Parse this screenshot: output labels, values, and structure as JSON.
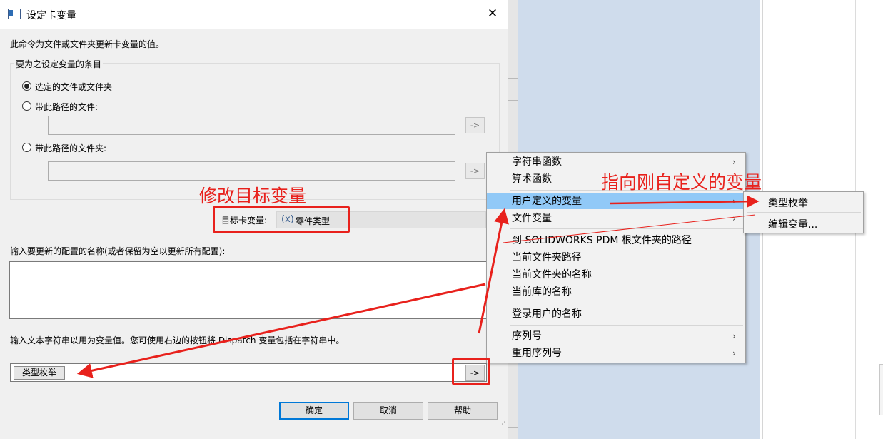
{
  "dialog": {
    "title": "设定卡变量",
    "description": "此命令为文件或文件夹更新卡变量的值。",
    "group_title": "要为之设定变量的条目",
    "radio_options": [
      {
        "label": "选定的文件或文件夹",
        "checked": true
      },
      {
        "label": "带此路径的文件:",
        "checked": false
      },
      {
        "label": "带此路径的文件夹:",
        "checked": false
      }
    ],
    "path_file_value": "",
    "path_folder_value": "",
    "arrow_label": "->",
    "target_var_label": "目标卡变量:",
    "target_var_icon": "(x)",
    "target_var_value": "零件类型",
    "config_label": "输入要更新的配置的名称(或者保留为空以更新所有配置):",
    "config_value": "",
    "value_label": "输入文本字符串以用为变量值。您可使用右边的按钮将 Dispatch 变量包括在字符串中。",
    "value_chip": "类型枚举",
    "buttons": {
      "ok": "确定",
      "cancel": "取消",
      "help": "帮助"
    }
  },
  "context_menu": {
    "items": [
      {
        "label": "字符串函数",
        "submenu": true
      },
      {
        "label": "算术函数",
        "submenu": false
      },
      {
        "label": "用户定义的变量",
        "submenu": true,
        "highlighted": true
      },
      {
        "label": "文件变量",
        "submenu": true
      },
      {
        "label": "到 SOLIDWORKS PDM 根文件夹的路径",
        "submenu": false
      },
      {
        "label": "当前文件夹路径",
        "submenu": false
      },
      {
        "label": "当前文件夹的名称",
        "submenu": false
      },
      {
        "label": "当前库的名称",
        "submenu": false
      },
      {
        "label": "登录用户的名称",
        "submenu": false
      },
      {
        "label": "序列号",
        "submenu": true
      },
      {
        "label": "重用序列号",
        "submenu": true
      }
    ],
    "chevron": "›"
  },
  "submenu": {
    "items": [
      "类型枚举",
      "编辑变量..."
    ]
  },
  "annotations": {
    "modify_target": "修改目标变量",
    "point_to_custom": "指向刚自定义的变量",
    "color": "#e8211c"
  }
}
